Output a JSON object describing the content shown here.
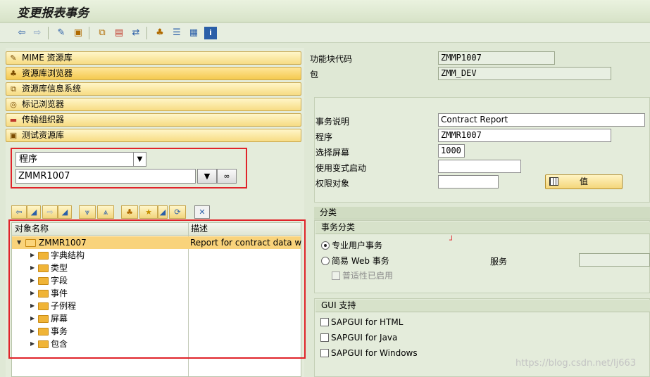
{
  "title": "变更报表事务",
  "toolbar_icons": [
    "back-icon",
    "forward-icon",
    "edit-icon",
    "other-object-icon",
    "hierarchy-icon",
    "display-object-icon",
    "where-used-icon",
    "tree-icon",
    "list-icon",
    "table-icon",
    "info-icon"
  ],
  "nav": {
    "items": [
      {
        "label": "MIME 资源库",
        "icon": "mime-icon"
      },
      {
        "label": "资源库浏览器",
        "icon": "repository-browser-icon"
      },
      {
        "label": "资源库信息系统",
        "icon": "info-system-icon"
      },
      {
        "label": "标记浏览器",
        "icon": "tag-browser-icon"
      },
      {
        "label": "传输组织器",
        "icon": "transport-icon"
      },
      {
        "label": "测试资源库",
        "icon": "test-repository-icon"
      }
    ]
  },
  "object_selector": {
    "type_value": "程序",
    "object_value": "ZMMR1007"
  },
  "tree": {
    "col_name": "对象名称",
    "col_desc": "描述",
    "root": {
      "label": "ZMMR1007",
      "desc": "Report for contract data with"
    },
    "children": [
      "字典结构",
      "类型",
      "字段",
      "事件",
      "子例程",
      "屏幕",
      "事务",
      "包含"
    ]
  },
  "header_fields": {
    "func_code_label": "功能块代码",
    "func_code_value": "ZMMP1007",
    "package_label": "包",
    "package_value": "ZMM_DEV"
  },
  "details": {
    "desc_label": "事务说明",
    "desc_value": "Contract Report",
    "program_label": "程序",
    "program_value": "ZMMR1007",
    "screen_label": "选择屏幕",
    "screen_value": "1000",
    "variant_label": "使用变式启动",
    "variant_value": "",
    "auth_label": "权限对象",
    "auth_value": "",
    "values_button": "值"
  },
  "category": {
    "title": "分类",
    "tx_title": "事务分类",
    "opt_pro": "专业用户事务",
    "opt_web": "简易 Web 事务",
    "service_label": "服务",
    "service_value": "",
    "chk_pervasive": "普适性已启用"
  },
  "gui": {
    "title": "GUI 支持",
    "html": "SAPGUI for HTML",
    "java": "SAPGUI for Java",
    "windows": "SAPGUI for Windows"
  },
  "watermark": "https://blog.csdn.net/lj663"
}
